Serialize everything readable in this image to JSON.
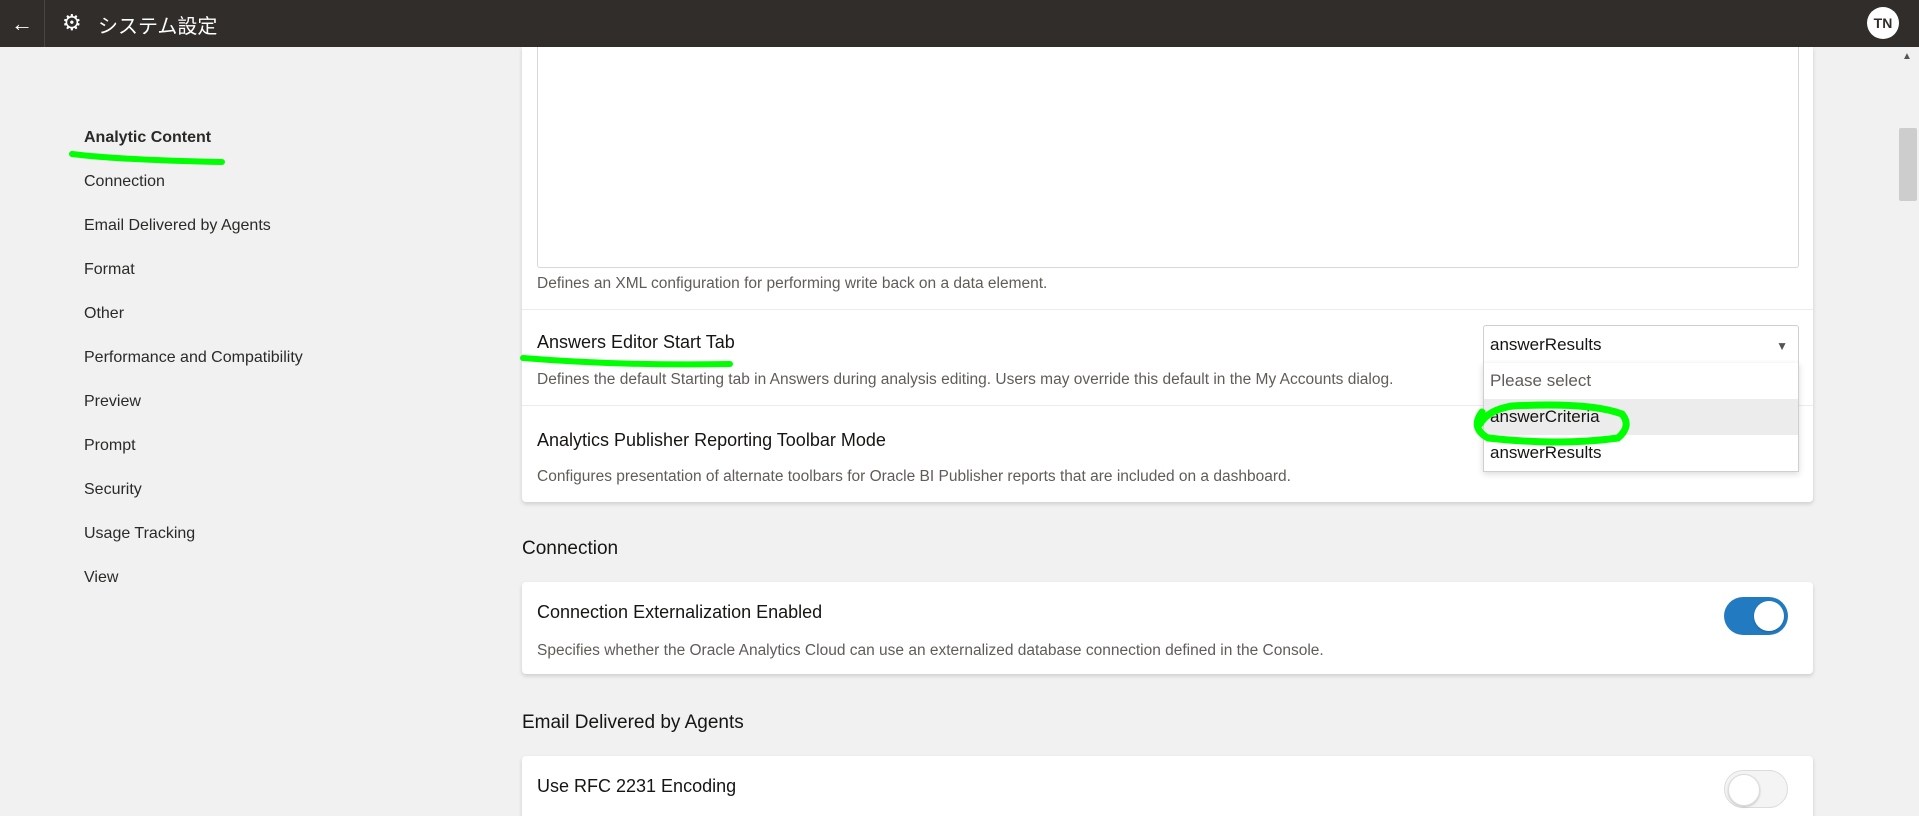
{
  "header": {
    "back_icon": "←",
    "gear_icon": "⚙",
    "title": "システム設定",
    "avatar_initials": "TN"
  },
  "sidebar": {
    "items": [
      {
        "label": "Analytic Content"
      },
      {
        "label": "Connection"
      },
      {
        "label": "Email Delivered by Agents"
      },
      {
        "label": "Format"
      },
      {
        "label": "Other"
      },
      {
        "label": "Performance and Compatibility"
      },
      {
        "label": "Preview"
      },
      {
        "label": "Prompt"
      },
      {
        "label": "Security"
      },
      {
        "label": "Usage Tracking"
      },
      {
        "label": "View"
      }
    ]
  },
  "analytic": {
    "xml_desc": "Defines an XML configuration for performing write back on a data element.",
    "start_tab_label": "Answers Editor Start Tab",
    "start_tab_desc": "Defines the default Starting tab in Answers during analysis editing. Users may override this default in the My Accounts dialog.",
    "start_tab_value": "answerResults",
    "start_tab_options": [
      "Please select",
      "answerCriteria",
      "answerResults"
    ],
    "publisher_label": "Analytics Publisher Reporting Toolbar Mode",
    "publisher_desc": "Configures presentation of alternate toolbars for Oracle BI Publisher reports that are included on a dashboard."
  },
  "connection": {
    "section_title": "Connection",
    "ext_label": "Connection Externalization Enabled",
    "ext_desc": "Specifies whether the Oracle Analytics Cloud can use an externalized database connection defined in the Console.",
    "ext_enabled": true
  },
  "email": {
    "section_title": "Email Delivered by Agents",
    "rfc_label": "Use RFC 2231 Encoding",
    "rfc_enabled": false
  },
  "colors": {
    "header_bg": "#312d2a",
    "toggle_on": "#227bc1",
    "highlight": "#00ff00"
  }
}
